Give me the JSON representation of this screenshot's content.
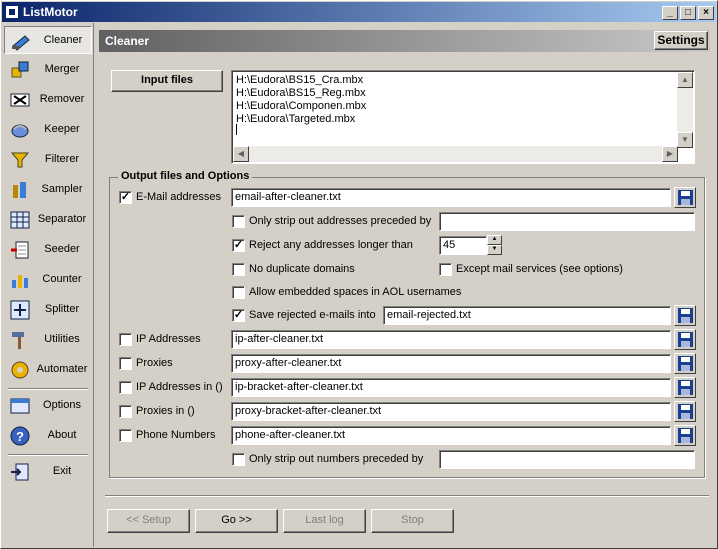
{
  "window": {
    "title": "ListMotor"
  },
  "sidebar": {
    "items": [
      {
        "label": "Cleaner",
        "icon": "broom-icon"
      },
      {
        "label": "Merger",
        "icon": "puzzle-icon"
      },
      {
        "label": "Remover",
        "icon": "remove-icon"
      },
      {
        "label": "Keeper",
        "icon": "keeper-icon"
      },
      {
        "label": "Filterer",
        "icon": "funnel-icon"
      },
      {
        "label": "Sampler",
        "icon": "sampler-icon"
      },
      {
        "label": "Separator",
        "icon": "grid-icon"
      },
      {
        "label": "Seeder",
        "icon": "seeder-icon"
      },
      {
        "label": "Counter",
        "icon": "bar-chart-icon"
      },
      {
        "label": "Splitter",
        "icon": "splitter-icon"
      },
      {
        "label": "Utilities",
        "icon": "hammer-icon"
      },
      {
        "label": "Automater",
        "icon": "gear-icon"
      },
      {
        "label": "Options",
        "icon": "options-icon"
      },
      {
        "label": "About",
        "icon": "help-icon"
      },
      {
        "label": "Exit",
        "icon": "exit-icon"
      }
    ]
  },
  "header": {
    "title": "Cleaner",
    "settings_label": "Settings"
  },
  "input": {
    "button_label": "Input files",
    "files": [
      "H:\\Eudora\\BS15_Cra.mbx",
      "H:\\Eudora\\BS15_Reg.mbx",
      "H:\\Eudora\\Componen.mbx",
      "H:\\Eudora\\Targeted.mbx"
    ]
  },
  "output": {
    "group_title": "Output files and Options",
    "email": {
      "label": "E-Mail addresses",
      "checked": true,
      "file": "email-after-cleaner.txt"
    },
    "strip_preceded": {
      "label": "Only strip out addresses preceded by",
      "checked": false,
      "value": ""
    },
    "reject_longer": {
      "label": "Reject any addresses longer than",
      "checked": true,
      "value": "45"
    },
    "no_duplicate_domains": {
      "label": "No duplicate domains",
      "checked": false
    },
    "except_mail_services": {
      "label": "Except mail services (see options)",
      "checked": false
    },
    "allow_spaces_aol": {
      "label": "Allow embedded spaces in AOL usernames",
      "checked": false
    },
    "save_rejected": {
      "label": "Save rejected e-mails into",
      "checked": true,
      "file": "email-rejected.txt"
    },
    "ip": {
      "label": "IP Addresses",
      "checked": false,
      "file": "ip-after-cleaner.txt"
    },
    "proxies": {
      "label": "Proxies",
      "checked": false,
      "file": "proxy-after-cleaner.txt"
    },
    "ip_bracket": {
      "label": "IP Addresses in ()",
      "checked": false,
      "file": "ip-bracket-after-cleaner.txt"
    },
    "proxies_bracket": {
      "label": "Proxies in ()",
      "checked": false,
      "file": "proxy-bracket-after-cleaner.txt"
    },
    "phone": {
      "label": "Phone Numbers",
      "checked": false,
      "file": "phone-after-cleaner.txt"
    },
    "strip_numbers": {
      "label": "Only strip out numbers preceded by",
      "checked": false,
      "value": ""
    }
  },
  "actions": {
    "setup": "<< Setup",
    "go": "Go >>",
    "lastlog": "Last log",
    "stop": "Stop"
  },
  "check_mark": "✓"
}
